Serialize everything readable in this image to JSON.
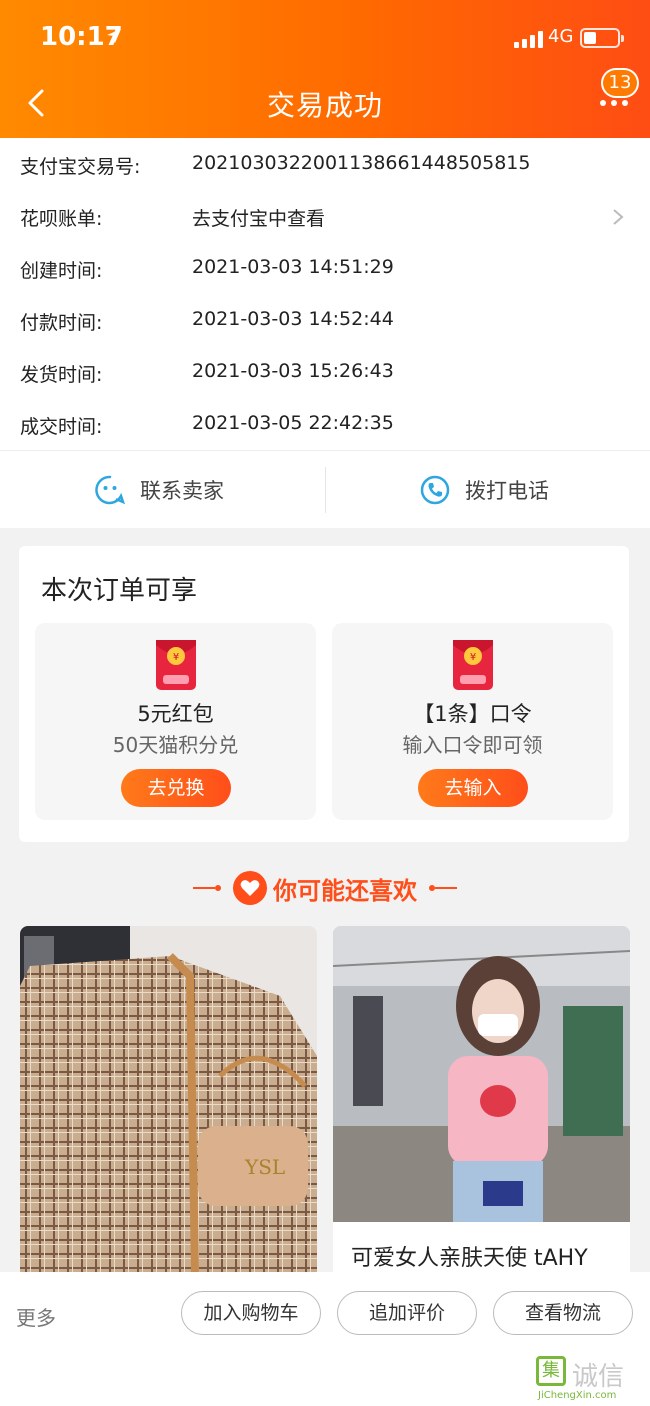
{
  "status_bar": {
    "time": "10:17",
    "network": "4G"
  },
  "header": {
    "title": "交易成功",
    "badge": "13"
  },
  "order_info": [
    {
      "label": "支付宝交易号:",
      "value": "2021030322001138661448505815"
    },
    {
      "label": "花呗账单:",
      "value": "去支付宝中查看"
    },
    {
      "label": "创建时间:",
      "value": "2021-03-03 14:51:29"
    },
    {
      "label": "付款时间:",
      "value": "2021-03-03 14:52:44"
    },
    {
      "label": "发货时间:",
      "value": "2021-03-03 15:26:43"
    },
    {
      "label": "成交时间:",
      "value": "2021-03-05 22:42:35"
    }
  ],
  "contact": {
    "seller": "联系卖家",
    "phone": "拨打电话"
  },
  "benefits": {
    "title": "本次订单可享",
    "items": [
      {
        "name": "5元红包",
        "desc": "50天猫积分兑",
        "button": "去兑换"
      },
      {
        "name": "【1条】口令",
        "desc": "输入口令即可领",
        "button": "去输入"
      }
    ]
  },
  "recommend": {
    "title": "你可能还喜欢",
    "items": [
      {
        "title": ""
      },
      {
        "title": "可爱女人亲肤天使 tAHY"
      }
    ]
  },
  "bottom_bar": {
    "more": "更多",
    "buttons": [
      "加入购物车",
      "追加评价",
      "查看物流"
    ]
  },
  "watermark": {
    "main": "集诚信",
    "sub": "JiChengXin.com"
  },
  "colors": {
    "primary": "#ff6a00",
    "accent": "#ff4e1a",
    "blue_icon": "#2ea7e0"
  }
}
